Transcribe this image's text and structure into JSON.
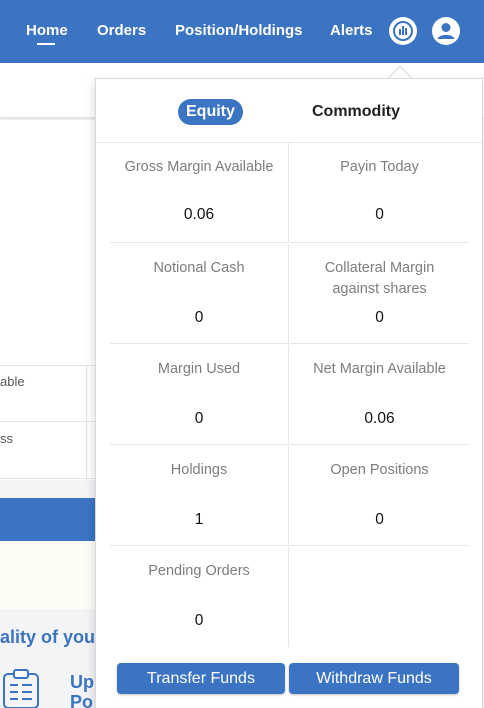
{
  "nav": {
    "items": [
      {
        "label": "Home"
      },
      {
        "label": "Orders"
      },
      {
        "label": "Position/Holdings"
      },
      {
        "label": "Alerts"
      }
    ],
    "active": "Home",
    "icons": [
      "funds-icon",
      "profile-icon"
    ],
    "accent_color": "#3b74c2"
  },
  "background": {
    "table_rows": [
      {
        "text": "able"
      },
      {
        "text": "ss"
      }
    ],
    "heading": "ality of your",
    "upload_text_line1": "Upl",
    "upload_text_line2": "Po"
  },
  "margin_panel": {
    "tabs": [
      {
        "label": "Equity",
        "active": true
      },
      {
        "label": "Commodity",
        "active": false
      }
    ],
    "cells": [
      {
        "label": "Gross Margin Available",
        "value": "0.06"
      },
      {
        "label": "Payin Today",
        "value": "0"
      },
      {
        "label": "Notional Cash",
        "value": "0"
      },
      {
        "label": "Collateral Margin against shares",
        "value": "0"
      },
      {
        "label": "Margin Used",
        "value": "0"
      },
      {
        "label": "Net Margin Available",
        "value": "0.06"
      },
      {
        "label": "Holdings",
        "value": "1"
      },
      {
        "label": "Open Positions",
        "value": "0"
      },
      {
        "label": "Pending Orders",
        "value": "0"
      }
    ],
    "buttons": {
      "transfer": "Transfer Funds",
      "withdraw": "Withdraw Funds"
    }
  }
}
